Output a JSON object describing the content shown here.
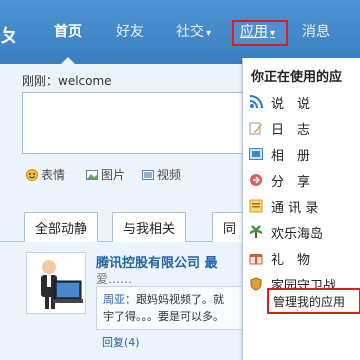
{
  "nav": {
    "edge_glyph": "ㄆ",
    "items": [
      {
        "label": "首页",
        "active": true
      },
      {
        "label": "好友"
      },
      {
        "label": "社交"
      },
      {
        "label": "应用"
      },
      {
        "label": "消息"
      }
    ]
  },
  "composer": {
    "label": "刚刚：welcome",
    "tools": [
      {
        "label": "表情",
        "icon": "smile-icon"
      },
      {
        "label": "图片",
        "icon": "image-icon"
      },
      {
        "label": "视频",
        "icon": "video-icon"
      }
    ]
  },
  "tabs": [
    "全部动静",
    "与我相关",
    "同"
  ],
  "feed": {
    "title": "腾讯控股有限公司 最",
    "sub": "爱……",
    "quote_who": "周亚：",
    "quote_line1": "跟妈妈视频了。就",
    "quote_line2": "宇了得。。。要是可以多。",
    "reply": "回复(4)"
  },
  "dropdown": {
    "title": "你正在使用的应",
    "items": [
      {
        "label": "说　说",
        "icon": "rss-icon",
        "color": "#2a78c9"
      },
      {
        "label": "日　志",
        "icon": "pencil-icon",
        "color": "#e0a030"
      },
      {
        "label": "相　册",
        "icon": "album-icon",
        "color": "#3a8bd0"
      },
      {
        "label": "分　享",
        "icon": "share-icon",
        "color": "#e05a5a"
      },
      {
        "label": "通 讯 录",
        "icon": "contacts-icon",
        "color": "#e8c050"
      },
      {
        "label": "欢乐海岛",
        "icon": "island-icon",
        "color": "#3b9a3b"
      },
      {
        "label": "礼　物",
        "icon": "gift-icon",
        "color": "#d0602a"
      },
      {
        "label": "家园守卫战",
        "icon": "shield-icon",
        "color": "#e0a030"
      }
    ],
    "manage": "管理我的应用"
  }
}
